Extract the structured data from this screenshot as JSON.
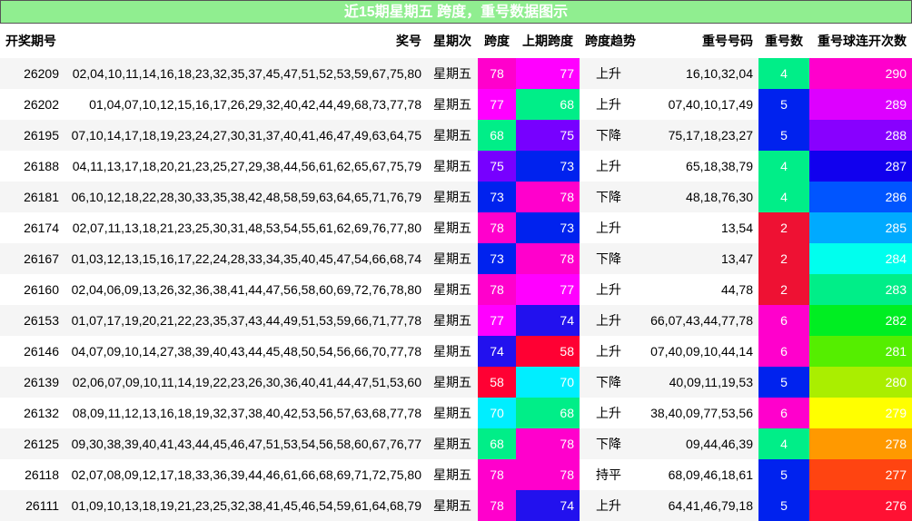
{
  "title": "近15期星期五 跨度，重号数据图示",
  "headers": {
    "period": "开奖期号",
    "numbers": "奖号",
    "weekday": "星期次",
    "span": "跨度",
    "prev_span": "上期跨度",
    "trend": "跨度趋势",
    "repeat_numbers": "重号号码",
    "repeat_count": "重号数",
    "consecutive": "重号球连开次数"
  },
  "rows": [
    {
      "period": "26209",
      "numbers": "02,04,10,11,14,16,18,23,32,35,37,45,47,51,52,53,59,67,75,80",
      "weekday": "星期五",
      "span": "78",
      "span_color": "#ff00cc",
      "prev_span": "77",
      "prev_span_color": "#ff00ff",
      "trend": "上升",
      "repeat_numbers": "16,10,32,04",
      "repeat_count": "4",
      "repeat_count_color": "#00ee88",
      "consecutive": "290",
      "consecutive_color": "#ff00cc"
    },
    {
      "period": "26202",
      "numbers": "01,04,07,10,12,15,16,17,26,29,32,40,42,44,49,68,73,77,78",
      "weekday": "星期五",
      "span": "77",
      "span_color": "#ff00ff",
      "prev_span": "68",
      "prev_span_color": "#00ee88",
      "trend": "上升",
      "repeat_numbers": "07,40,10,17,49",
      "repeat_count": "5",
      "repeat_count_color": "#0022ee",
      "consecutive": "289",
      "consecutive_color": "#dd00ff"
    },
    {
      "period": "26195",
      "numbers": "07,10,14,17,18,19,23,24,27,30,31,37,40,41,46,47,49,63,64,75",
      "weekday": "星期五",
      "span": "68",
      "span_color": "#00ee88",
      "prev_span": "75",
      "prev_span_color": "#7700ff",
      "trend": "下降",
      "repeat_numbers": "75,17,18,23,27",
      "repeat_count": "5",
      "repeat_count_color": "#0022ee",
      "consecutive": "288",
      "consecutive_color": "#8800ff"
    },
    {
      "period": "26188",
      "numbers": "04,11,13,17,18,20,21,23,25,27,29,38,44,56,61,62,65,67,75,79",
      "weekday": "星期五",
      "span": "75",
      "span_color": "#7700ff",
      "prev_span": "73",
      "prev_span_color": "#0022ee",
      "trend": "上升",
      "repeat_numbers": "65,18,38,79",
      "repeat_count": "4",
      "repeat_count_color": "#00ee88",
      "consecutive": "287",
      "consecutive_color": "#1100ee"
    },
    {
      "period": "26181",
      "numbers": "06,10,12,18,22,28,30,33,35,38,42,48,58,59,63,64,65,71,76,79",
      "weekday": "星期五",
      "span": "73",
      "span_color": "#0022ee",
      "prev_span": "78",
      "prev_span_color": "#ff00cc",
      "trend": "下降",
      "repeat_numbers": "48,18,76,30",
      "repeat_count": "4",
      "repeat_count_color": "#00ee88",
      "consecutive": "286",
      "consecutive_color": "#0055ff"
    },
    {
      "period": "26174",
      "numbers": "02,07,11,13,18,21,23,25,30,31,48,53,54,55,61,62,69,76,77,80",
      "weekday": "星期五",
      "span": "78",
      "span_color": "#ff00cc",
      "prev_span": "73",
      "prev_span_color": "#0022ee",
      "trend": "上升",
      "repeat_numbers": "13,54",
      "repeat_count": "2",
      "repeat_count_color": "#ee1133",
      "consecutive": "285",
      "consecutive_color": "#00aaff"
    },
    {
      "period": "26167",
      "numbers": "01,03,12,13,15,16,17,22,24,28,33,34,35,40,45,47,54,66,68,74",
      "weekday": "星期五",
      "span": "73",
      "span_color": "#0022ee",
      "prev_span": "78",
      "prev_span_color": "#ff00cc",
      "trend": "下降",
      "repeat_numbers": "13,47",
      "repeat_count": "2",
      "repeat_count_color": "#ee1133",
      "consecutive": "284",
      "consecutive_color": "#00ffee"
    },
    {
      "period": "26160",
      "numbers": "02,04,06,09,13,26,32,36,38,41,44,47,56,58,60,69,72,76,78,80",
      "weekday": "星期五",
      "span": "78",
      "span_color": "#ff00cc",
      "prev_span": "77",
      "prev_span_color": "#ff00ff",
      "trend": "上升",
      "repeat_numbers": "44,78",
      "repeat_count": "2",
      "repeat_count_color": "#ee1133",
      "consecutive": "283",
      "consecutive_color": "#00ee88"
    },
    {
      "period": "26153",
      "numbers": "01,07,17,19,20,21,22,23,35,37,43,44,49,51,53,59,66,71,77,78",
      "weekday": "星期五",
      "span": "77",
      "span_color": "#ff00ff",
      "prev_span": "74",
      "prev_span_color": "#2211ee",
      "trend": "上升",
      "repeat_numbers": "66,07,43,44,77,78",
      "repeat_count": "6",
      "repeat_count_color": "#ff00cc",
      "consecutive": "282",
      "consecutive_color": "#00ee22"
    },
    {
      "period": "26146",
      "numbers": "04,07,09,10,14,27,38,39,40,43,44,45,48,50,54,56,66,70,77,78",
      "weekday": "星期五",
      "span": "74",
      "span_color": "#2211ee",
      "prev_span": "58",
      "prev_span_color": "#ff0033",
      "trend": "上升",
      "repeat_numbers": "07,40,09,10,44,14",
      "repeat_count": "6",
      "repeat_count_color": "#ff00cc",
      "consecutive": "281",
      "consecutive_color": "#55ee00"
    },
    {
      "period": "26139",
      "numbers": "02,06,07,09,10,11,14,19,22,23,26,30,36,40,41,44,47,51,53,60",
      "weekday": "星期五",
      "span": "58",
      "span_color": "#ff0033",
      "prev_span": "70",
      "prev_span_color": "#00eeff",
      "trend": "下降",
      "repeat_numbers": "40,09,11,19,53",
      "repeat_count": "5",
      "repeat_count_color": "#0022ee",
      "consecutive": "280",
      "consecutive_color": "#aaee00"
    },
    {
      "period": "26132",
      "numbers": "08,09,11,12,13,16,18,19,32,37,38,40,42,53,56,57,63,68,77,78",
      "weekday": "星期五",
      "span": "70",
      "span_color": "#00eeff",
      "prev_span": "68",
      "prev_span_color": "#00ee88",
      "trend": "上升",
      "repeat_numbers": "38,40,09,77,53,56",
      "repeat_count": "6",
      "repeat_count_color": "#ff00cc",
      "consecutive": "279",
      "consecutive_color": "#ffff00"
    },
    {
      "period": "26125",
      "numbers": "09,30,38,39,40,41,43,44,45,46,47,51,53,54,56,58,60,67,76,77",
      "weekday": "星期五",
      "span": "68",
      "span_color": "#00ee88",
      "prev_span": "78",
      "prev_span_color": "#ff00cc",
      "trend": "下降",
      "repeat_numbers": "09,44,46,39",
      "repeat_count": "4",
      "repeat_count_color": "#00ee88",
      "consecutive": "278",
      "consecutive_color": "#ff9900"
    },
    {
      "period": "26118",
      "numbers": "02,07,08,09,12,17,18,33,36,39,44,46,61,66,68,69,71,72,75,80",
      "weekday": "星期五",
      "span": "78",
      "span_color": "#ff00cc",
      "prev_span": "78",
      "prev_span_color": "#ff00cc",
      "trend": "持平",
      "repeat_numbers": "68,09,46,18,61",
      "repeat_count": "5",
      "repeat_count_color": "#0022ee",
      "consecutive": "277",
      "consecutive_color": "#ff4411"
    },
    {
      "period": "26111",
      "numbers": "01,09,10,13,18,19,21,23,25,32,38,41,45,46,54,59,61,64,68,79",
      "weekday": "星期五",
      "span": "78",
      "span_color": "#ff00cc",
      "prev_span": "74",
      "prev_span_color": "#2211ee",
      "trend": "上升",
      "repeat_numbers": "64,41,46,79,18",
      "repeat_count": "5",
      "repeat_count_color": "#0022ee",
      "consecutive": "276",
      "consecutive_color": "#ff1133"
    }
  ]
}
